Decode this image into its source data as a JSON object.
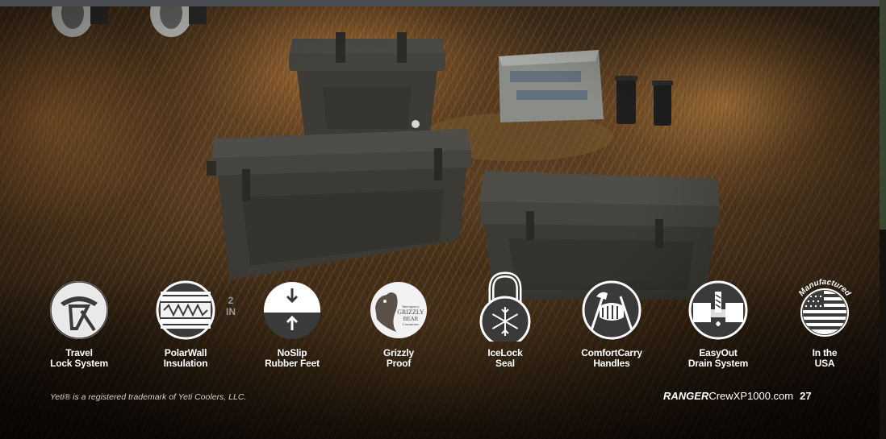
{
  "features": [
    {
      "icon": "travel-lock-icon",
      "line1": "Travel",
      "line2": "Lock System"
    },
    {
      "icon": "polarwall-insulation-icon",
      "line1": "PolarWall",
      "line2": "Insulation",
      "badge": "2 IN"
    },
    {
      "icon": "noslip-feet-icon",
      "line1": "NoSlip",
      "line2": "Rubber Feet"
    },
    {
      "icon": "grizzly-bear-icon",
      "line1": "Grizzly",
      "line2": "Proof",
      "seal_lines": [
        "Interagency",
        "GRIZZLY",
        "BEAR",
        "Committee"
      ]
    },
    {
      "icon": "icelock-padlock-icon",
      "line1": "IceLock",
      "line2": "Seal"
    },
    {
      "icon": "comfortcarry-handle-icon",
      "line1": "ComfortCarry",
      "line2": "Handles"
    },
    {
      "icon": "easyout-drain-icon",
      "line1": "EasyOut",
      "line2": "Drain System"
    },
    {
      "icon": "usa-flag-icon",
      "line1": "In the",
      "line2": "USA",
      "arc_text": "Manufactured"
    }
  ],
  "footer": {
    "trademark": "Yeti® is a registered trademark of Yeti Coolers, LLC.",
    "brand": "RANGER",
    "domain": "CrewXP1000.com",
    "page_number": "27"
  },
  "colors": {
    "icon_bg": "#ffffff",
    "icon_fg": "#3a3a3a",
    "label_text": "#ffffff",
    "cooler_body": "#3e3d38"
  }
}
